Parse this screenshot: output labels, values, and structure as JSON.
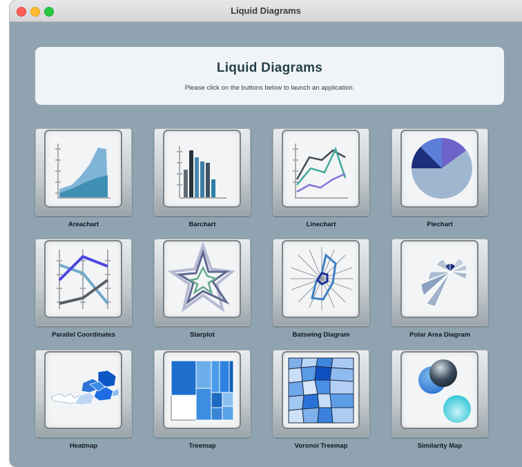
{
  "window": {
    "title": "Liquid Diagrams"
  },
  "header": {
    "title": "Liquid Diagrams",
    "subtitle": "Please click on the buttons below to launch an application."
  },
  "apps": [
    {
      "label": "Areachart",
      "icon": "areachart-icon"
    },
    {
      "label": "Barchart",
      "icon": "barchart-icon"
    },
    {
      "label": "Linechart",
      "icon": "linechart-icon"
    },
    {
      "label": "Piechart",
      "icon": "piechart-icon"
    },
    {
      "label": "Parallel Coordinates",
      "icon": "parallel-coordinates-icon"
    },
    {
      "label": "Starplot",
      "icon": "starplot-icon"
    },
    {
      "label": "Batswing Diagram",
      "icon": "batswing-diagram-icon"
    },
    {
      "label": "Polar Area Diagram",
      "icon": "polar-area-diagram-icon"
    },
    {
      "label": "Heatmap",
      "icon": "heatmap-icon"
    },
    {
      "label": "Treemap",
      "icon": "treemap-icon"
    },
    {
      "label": "Voronoi Treemap",
      "icon": "voronoi-treemap-icon"
    },
    {
      "label": "Similarity Map",
      "icon": "similarity-map-icon"
    }
  ]
}
